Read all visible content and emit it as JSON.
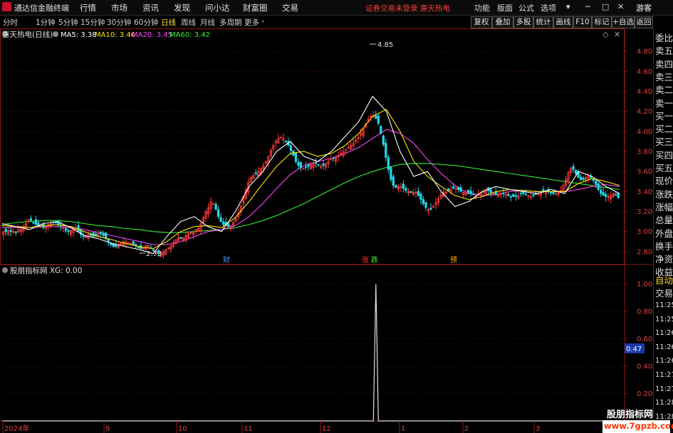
{
  "app": {
    "title": "通达信金融终端"
  },
  "menu": [
    "行情",
    "市场",
    "资讯",
    "发现",
    "问小达",
    "财富圈",
    "交易"
  ],
  "trade_status": "证券交易未登录  惠天热电",
  "window_controls": [
    "功能",
    "版面",
    "公式",
    "选项"
  ],
  "user": "游客",
  "period_tabs": [
    "分时",
    "1分钟",
    "5分钟",
    "15分钟",
    "30分钟",
    "60分钟",
    "日线",
    "周线",
    "月线",
    "多周期",
    "更多"
  ],
  "active_period": "日线",
  "tool_buttons": [
    "复权",
    "叠加",
    "多股",
    "统计",
    "画线",
    "F10",
    "标记",
    "+自选",
    "返回"
  ],
  "main_chart": {
    "stock_title": "惠天热电(日线)",
    "ma_labels": [
      {
        "text": "MA5: 3.38",
        "color": "#ffffff"
      },
      {
        "text": "MA10: 3.46",
        "color": "#ffe500"
      },
      {
        "text": "MA20: 3.45",
        "color": "#ff44ff"
      },
      {
        "text": "MA60: 3.42",
        "color": "#33ee33"
      }
    ],
    "high_label": "4.85",
    "low_label": "2.73",
    "event_markers": [
      {
        "text": "财",
        "color": "#4d8fff"
      },
      {
        "text": "涨",
        "color": "#ff3333"
      },
      {
        "text": "跌",
        "color": "#33ee33"
      },
      {
        "text": "预",
        "color": "#ffaa00"
      }
    ]
  },
  "sub_chart": {
    "title": "股朋指标网 XG: 0.00",
    "current_value": "0.47"
  },
  "x_axis_labels": [
    "2024年",
    "9",
    "10",
    "11",
    "12",
    "1",
    "2",
    "3"
  ],
  "right_panel": {
    "items": [
      "委比",
      "卖五",
      "卖四",
      "卖三",
      "卖二",
      "卖一",
      "买一",
      "买二",
      "买三",
      "买四",
      "买五",
      "现价",
      "涨跌",
      "涨幅",
      "总量",
      "外盘",
      "换手",
      "净资",
      "收益"
    ],
    "lower_items": [
      "自动",
      "交易"
    ],
    "times": [
      "11:25",
      "11:25",
      "11:26",
      "11:26",
      "11:26",
      "11:27",
      "11:27",
      "11:28",
      "11:28"
    ]
  },
  "watermark": {
    "name": "股朋指标网",
    "url": "www.7gpzb.com"
  },
  "chart_data": [
    {
      "type": "candlestick",
      "title": "惠天热电(日线)",
      "y_ticks": [
        "4.80",
        "4.60",
        "4.40",
        "4.20",
        "4.00",
        "3.80",
        "3.60",
        "3.40",
        "3.20",
        "3.00",
        "2.80"
      ],
      "ylim": [
        2.7,
        4.9
      ],
      "colors": {
        "up": "#ff3b3b",
        "down": "#23d7e6",
        "ma5": "#ffffff",
        "ma10": "#ffe500",
        "ma20": "#ff44ff",
        "ma60": "#33ee33"
      },
      "x": [
        "d1",
        "d2",
        "d3",
        "d4",
        "d5",
        "d6",
        "d7",
        "d8",
        "d9",
        "d10",
        "d11",
        "d12",
        "d13",
        "d14",
        "d15",
        "d16",
        "d17",
        "d18",
        "d19",
        "d20",
        "d21",
        "d22",
        "d23",
        "d24",
        "d25",
        "d26",
        "d27",
        "d28",
        "d29",
        "d30",
        "d31",
        "d32",
        "d33",
        "d34",
        "d35",
        "d36",
        "d37",
        "d38",
        "d39",
        "d40",
        "d41",
        "d42",
        "d43",
        "d44",
        "d45",
        "d46",
        "d47",
        "d48",
        "d49",
        "d50",
        "d51",
        "d52",
        "d53",
        "d54",
        "d55",
        "d56",
        "d57",
        "d58",
        "d59",
        "d60",
        "d61",
        "d62",
        "d63",
        "d64",
        "d65",
        "d66",
        "d67",
        "d68",
        "d69",
        "d70",
        "d71",
        "d72",
        "d73",
        "d74",
        "d75",
        "d76",
        "d77",
        "d78",
        "d79",
        "d80",
        "d81",
        "d82",
        "d83",
        "d84",
        "d85",
        "d86",
        "d87",
        "d88",
        "d89",
        "d90",
        "d91",
        "d92",
        "d93",
        "d94",
        "d95",
        "d96",
        "d97",
        "d98",
        "d99",
        "d100",
        "d101",
        "d102",
        "d103",
        "d104",
        "d105",
        "d106",
        "d107",
        "d108",
        "d109",
        "d110",
        "d111",
        "d112",
        "d113",
        "d114",
        "d115",
        "d116",
        "d117",
        "d118",
        "d119",
        "d120",
        "d121",
        "d122",
        "d123",
        "d124",
        "d125",
        "d126",
        "d127",
        "d128",
        "d129",
        "d130",
        "d131",
        "d132",
        "d133",
        "d134",
        "d135",
        "d136",
        "d137",
        "d138",
        "d139",
        "d140",
        "d141",
        "d142",
        "d143",
        "d144",
        "d145",
        "d146",
        "d147",
        "d148",
        "d149",
        "d150",
        "d151",
        "d152",
        "d153",
        "d154",
        "d155",
        "d156",
        "d157",
        "d158",
        "d159",
        "d160",
        "d161",
        "d162",
        "d163",
        "d164",
        "d165",
        "d166",
        "d167",
        "d168",
        "d169",
        "d170",
        "d171",
        "d172",
        "d173",
        "d174",
        "d175",
        "d176",
        "d177",
        "d178",
        "d179",
        "d180",
        "d181",
        "d182",
        "d183",
        "d184",
        "d185",
        "d186",
        "d187",
        "d188",
        "d189",
        "d190",
        "d191",
        "d192",
        "d193",
        "d194",
        "d195",
        "d196",
        "d197",
        "d198",
        "d199",
        "d200",
        "d201",
        "d202",
        "d203",
        "d204",
        "d205",
        "d206",
        "d207",
        "d208",
        "d209",
        "d210",
        "d211",
        "d212",
        "d213",
        "d214",
        "d215",
        "d216",
        "d217",
        "d218",
        "d219",
        "d220",
        "d221",
        "d222",
        "d223",
        "d224",
        "d225",
        "d226",
        "d227",
        "d228",
        "d229",
        "d230",
        "d231",
        "d232",
        "d233",
        "d234",
        "d235",
        "d236",
        "d237",
        "d238",
        "d239",
        "d240",
        "d241",
        "d242",
        "d243",
        "d244",
        "d245",
        "d246",
        "d247"
      ],
      "series": [
        {
          "name": "close",
          "values": [
            3.0,
            3.0,
            3.01,
            3.0,
            3.0,
            2.99,
            3.02,
            3.02,
            3.05,
            3.08,
            3.11,
            3.11,
            3.09,
            3.07,
            3.05,
            3.05,
            3.04,
            3.04,
            3.06,
            3.08,
            3.09,
            3.09,
            3.07,
            3.06,
            3.04,
            3.01,
            3.0,
            3.01,
            3.03,
            3.03,
            3.0,
            2.97,
            2.95,
            2.95,
            2.97,
            2.96,
            2.95,
            2.96,
            2.98,
            2.98,
            2.96,
            2.93,
            2.9,
            2.87,
            2.85,
            2.85,
            2.87,
            2.88,
            2.9,
            2.9,
            2.89,
            2.88,
            2.87,
            2.86,
            2.84,
            2.83,
            2.84,
            2.86,
            2.86,
            2.84,
            2.81,
            2.79,
            2.78,
            2.79,
            2.8,
            2.82,
            2.84,
            2.86,
            2.89,
            2.92,
            2.94,
            2.93,
            2.94,
            2.96,
            2.98,
            2.99,
            3.0,
            3.02,
            3.03,
            3.08,
            3.14,
            3.2,
            3.24,
            3.3,
            3.28,
            3.22,
            3.15,
            3.1,
            3.07,
            3.06,
            3.05,
            3.06,
            3.09,
            3.13,
            3.18,
            3.26,
            3.35,
            3.42,
            3.49,
            3.54,
            3.56,
            3.58,
            3.6,
            3.63,
            3.66,
            3.7,
            3.75,
            3.81,
            3.86,
            3.9,
            3.93,
            3.94,
            3.93,
            3.9,
            3.86,
            3.81,
            3.76,
            3.7,
            3.66,
            3.64,
            3.63,
            3.64,
            3.65,
            3.67,
            3.68,
            3.68,
            3.66,
            3.65,
            3.66,
            3.68,
            3.7,
            3.72,
            3.73,
            3.74,
            3.76,
            3.78,
            3.8,
            3.82,
            3.84,
            3.86,
            3.88,
            3.91,
            3.94,
            3.98,
            4.03,
            4.08,
            4.12,
            4.15,
            4.16,
            4.13,
            4.08,
            3.98,
            3.87,
            3.74,
            3.62,
            3.52,
            3.46,
            3.44,
            3.45,
            3.45,
            3.43,
            3.41,
            3.4,
            3.39,
            3.39,
            3.39,
            3.36,
            3.32,
            3.28,
            3.24,
            3.22,
            3.22,
            3.25,
            3.29,
            3.33,
            3.37,
            3.39,
            3.4,
            3.41,
            3.42,
            3.43,
            3.43,
            3.42,
            3.4,
            3.39,
            3.39,
            3.39,
            3.38,
            3.37,
            3.37,
            3.38,
            3.39,
            3.4,
            3.41,
            3.41,
            3.39,
            3.38,
            3.37,
            3.37,
            3.38,
            3.38,
            3.37,
            3.36,
            3.35,
            3.35,
            3.35,
            3.36,
            3.38,
            3.38,
            3.37,
            3.36,
            3.35,
            3.36,
            3.37,
            3.38,
            3.39,
            3.4,
            3.4,
            3.4,
            3.39,
            3.38,
            3.38,
            3.39,
            3.41,
            3.46,
            3.52,
            3.59,
            3.63,
            3.62,
            3.58,
            3.54,
            3.52,
            3.52,
            3.54,
            3.55,
            3.54,
            3.51,
            3.47,
            3.42,
            3.38,
            3.36,
            3.35,
            3.35,
            3.36,
            3.38,
            3.37,
            3.34
          ]
        },
        {
          "name": "MA5",
          "values": [
            3.08,
            3.05,
            3.02,
            3.08,
            3.1,
            3.04,
            2.96,
            2.93,
            2.88,
            2.85,
            2.82,
            2.78,
            2.95,
            3.1,
            3.15,
            3.05,
            3.0,
            3.2,
            3.45,
            3.6,
            3.8,
            3.9,
            3.75,
            3.7,
            3.8,
            3.95,
            4.1,
            4.35,
            4.2,
            3.8,
            3.55,
            3.6,
            3.4,
            3.25,
            3.3,
            3.4,
            3.45,
            3.42,
            3.4,
            3.38,
            3.42,
            3.38,
            3.6,
            3.55,
            3.45,
            3.38
          ]
        },
        {
          "name": "MA10",
          "values": [
            3.06,
            3.05,
            3.04,
            3.06,
            3.07,
            3.05,
            3.0,
            2.95,
            2.92,
            2.88,
            2.85,
            2.83,
            2.9,
            3.0,
            3.05,
            3.06,
            3.04,
            3.14,
            3.3,
            3.48,
            3.65,
            3.78,
            3.8,
            3.75,
            3.78,
            3.86,
            3.98,
            4.15,
            4.22,
            4.0,
            3.7,
            3.55,
            3.45,
            3.36,
            3.32,
            3.35,
            3.4,
            3.42,
            3.41,
            3.4,
            3.4,
            3.4,
            3.48,
            3.53,
            3.5,
            3.46
          ]
        },
        {
          "name": "MA20",
          "values": [
            3.04,
            3.04,
            3.04,
            3.05,
            3.05,
            3.04,
            3.02,
            2.99,
            2.96,
            2.93,
            2.9,
            2.87,
            2.87,
            2.9,
            2.95,
            3.0,
            3.02,
            3.06,
            3.15,
            3.28,
            3.43,
            3.57,
            3.66,
            3.7,
            3.73,
            3.78,
            3.84,
            3.93,
            4.02,
            3.98,
            3.88,
            3.72,
            3.58,
            3.46,
            3.38,
            3.36,
            3.37,
            3.4,
            3.41,
            3.4,
            3.4,
            3.4,
            3.42,
            3.45,
            3.47,
            3.45
          ]
        },
        {
          "name": "MA60",
          "values": [
            3.07,
            3.09,
            3.1,
            3.11,
            3.11,
            3.1,
            3.08,
            3.06,
            3.05,
            3.03,
            3.02,
            3.0,
            2.99,
            2.99,
            3.0,
            3.01,
            3.02,
            3.04,
            3.07,
            3.11,
            3.16,
            3.22,
            3.28,
            3.35,
            3.42,
            3.49,
            3.55,
            3.6,
            3.64,
            3.67,
            3.68,
            3.68,
            3.67,
            3.66,
            3.64,
            3.62,
            3.6,
            3.58,
            3.56,
            3.54,
            3.52,
            3.5,
            3.48,
            3.46,
            3.44,
            3.42
          ]
        }
      ]
    },
    {
      "type": "line",
      "title": "股朋指标网 XG: 0.00",
      "y_ticks": [
        "1.00",
        "0.80",
        "0.60",
        "0.40",
        "0.20"
      ],
      "ylim": [
        0,
        1.05
      ],
      "series": [
        {
          "name": "XG",
          "points": [
            [
              0,
              0
            ],
            [
              148,
              0
            ],
            [
              149,
              1
            ],
            [
              150,
              0
            ],
            [
              247,
              0
            ]
          ]
        }
      ]
    }
  ]
}
